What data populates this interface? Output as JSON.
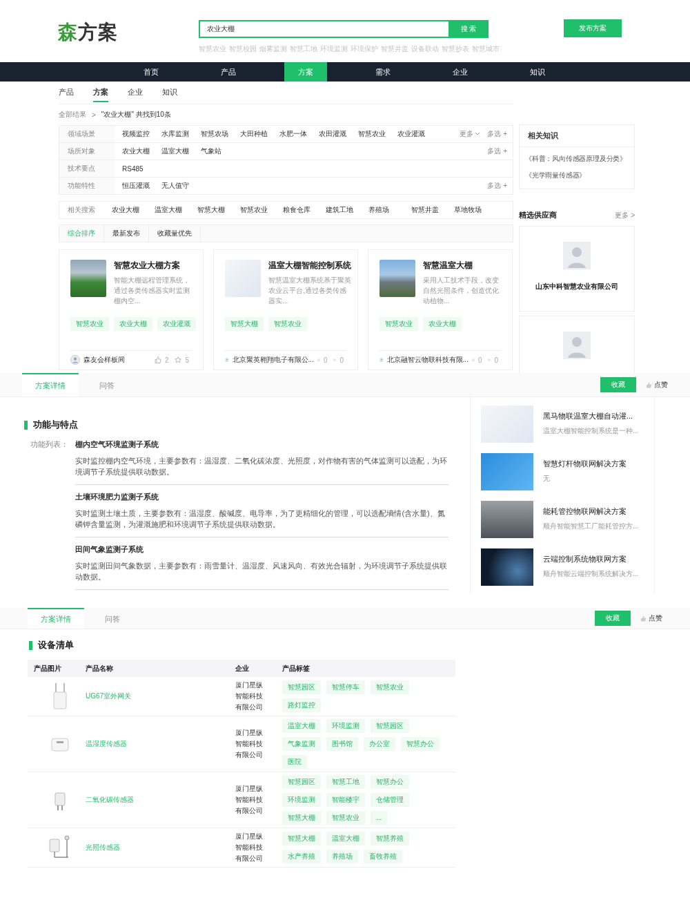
{
  "header": {
    "logo": {
      "accent": "森",
      "rest": "方案"
    },
    "search": {
      "value": "农业大棚",
      "button": "搜 索"
    },
    "hot_keywords": [
      "智慧农业",
      "智慧校园",
      "烟雾监测",
      "智慧工地",
      "环境监测",
      "环境保护",
      "智慧井盖",
      "设备联动",
      "智慧抄表",
      "智慧城市"
    ],
    "publish_button": "发布方案"
  },
  "nav": [
    {
      "label": "首页",
      "selected": false
    },
    {
      "label": "产品",
      "selected": false
    },
    {
      "label": "方案",
      "selected": true
    },
    {
      "label": "需求",
      "selected": false
    },
    {
      "label": "企业",
      "selected": false
    },
    {
      "label": "知识",
      "selected": false
    }
  ],
  "sub_tabs": [
    {
      "label": "产品",
      "selected": false
    },
    {
      "label": "方案",
      "selected": true
    },
    {
      "label": "企业",
      "selected": false
    },
    {
      "label": "知识",
      "selected": false
    }
  ],
  "breadcrumb": {
    "root": "全部结果",
    "separator": ">",
    "result": "\"农业大棚\" 共找到10条"
  },
  "filters": [
    {
      "label": "领域场景",
      "options": [
        "视频监控",
        "水库监测",
        "智慧农场",
        "大田种植",
        "水肥一体",
        "农田灌溉",
        "智慧农业",
        "农业灌溉"
      ],
      "more_label": "更多",
      "multi_label": "多选 +"
    },
    {
      "label": "场所对象",
      "options": [
        "农业大棚",
        "温室大棚",
        "气象站"
      ],
      "multi_label": "多选 +"
    },
    {
      "label": "技术要点",
      "options": [
        "RS485"
      ]
    },
    {
      "label": "功能特性",
      "options": [
        "恒压灌溉",
        "无人值守"
      ],
      "multi_label": "多选 +"
    }
  ],
  "related_search": {
    "label": "相关搜索",
    "items": [
      "农业大棚",
      "温室大棚",
      "智慧大棚",
      "智慧农业",
      "粮食仓库",
      "建筑工地",
      "养殖场",
      "智慧井盖",
      "草地牧场"
    ]
  },
  "sort_tabs": [
    {
      "label": "综合排序",
      "selected": true
    },
    {
      "label": "最新发布",
      "selected": false
    },
    {
      "label": "收藏量优先",
      "selected": false
    }
  ],
  "cards": [
    {
      "kind": "greenhouse",
      "title": "智慧农业大棚方案",
      "desc": "智能大棚远程管理系统，通过各类传感器实时监测棚内空...",
      "tags": [
        "智慧农业",
        "农业大棚",
        "农业灌溉"
      ],
      "author": "森友会样板间",
      "likes": "2",
      "stars": "5"
    },
    {
      "kind": "diagram",
      "title": "温室大棚智能控制系统",
      "desc": "智慧温室大棚系统基于聚英农业云平台,通过各类传感器实...",
      "tags": [
        "智慧大棚",
        "智慧农业"
      ],
      "author": "北京聚英翱翔电子有限公...",
      "likes": "0",
      "stars": "0"
    },
    {
      "kind": "building",
      "title": "智慧温室大棚",
      "desc": "采用人工技术手段，改变自然光照条件，创造优化动植物...",
      "tags": [
        "智慧农业",
        "农业大棚"
      ],
      "author": "北京融智云物联科技有限...",
      "likes": "0",
      "stars": "0"
    }
  ],
  "knowledge": {
    "title": "相关知识",
    "items": [
      "《科普：风向传感器原理及分类》",
      "《光学雨量传感器》"
    ]
  },
  "suppliers": {
    "title": "精选供应商",
    "more": "更多 >",
    "items": [
      {
        "kind": "named",
        "name": "山东中科智慧农业有限公司"
      },
      {
        "kind": "partial"
      }
    ]
  },
  "detail_tabs_1": {
    "tabs": [
      {
        "label": "方案详情",
        "selected": true
      },
      {
        "label": "问答",
        "selected": false
      }
    ],
    "collect": "收藏",
    "like": "点赞"
  },
  "features": {
    "heading": "功能与特点",
    "list_label": "功能列表：",
    "items": [
      {
        "title": "棚内空气环境监测子系统",
        "desc": "实时监控棚内空气环境，主要参数有：温湿度、二氧化碳浓度、光照度，对作物有害的气体监测可以选配，为环境调节子系统提供联动数据。"
      },
      {
        "title": "土壤环境肥力监测子系统",
        "desc": "实时监测土壤土质，主要参数有：温湿度、酸碱度、电导率，为了更精细化的管理，可以选配墒情(含水量)、氮磷钾含量监测，为灌溉施肥和环境调节子系统提供联动数据。"
      },
      {
        "title": "田间气象监测子系统",
        "desc": "实时监测田间气象数据，主要参数有：雨雪量计、温湿度、风速风向、有效光合辐射，为环境调节子系统提供联动数据。"
      }
    ]
  },
  "related_solutions": [
    {
      "kind": "diagram",
      "title": "黑马物联温室大棚自动灌...",
      "desc": "温室大棚智能控制系统是一种..."
    },
    {
      "kind": "blue",
      "title": "智慧灯杆物联网解决方案",
      "desc": "无"
    },
    {
      "kind": "factory",
      "title": "能耗管控物联网解决方案",
      "desc": "顺舟智能智慧工厂能耗管控方..."
    },
    {
      "kind": "network",
      "title": "云端控制系统物联网方案",
      "desc": "顺舟智能云端控制系统解决方..."
    }
  ],
  "detail_tabs_2": {
    "tabs": [
      {
        "label": "方案详情",
        "selected": true
      },
      {
        "label": "问答",
        "selected": false
      }
    ],
    "collect": "收藏",
    "like": "点赞"
  },
  "equipment": {
    "heading": "设备清单",
    "columns": [
      "产品图片",
      "产品名称",
      "企业",
      "产品标签"
    ],
    "rows": [
      {
        "kind": "gateway",
        "name": "UG67室外网关",
        "company": "厦门星纵智能科技有限公司",
        "tags": [
          "智慧园区",
          "智慧停车",
          "智慧农业",
          "路灯监控"
        ]
      },
      {
        "kind": "sensor",
        "name": "温湿度传感器",
        "company": "厦门星纵智能科技有限公司",
        "tags": [
          "温室大棚",
          "环境监测",
          "智慧园区",
          "气象监测",
          "图书馆",
          "办公室",
          "智慧办公",
          "医院"
        ]
      },
      {
        "kind": "plug",
        "name": "二氧化碳传感器",
        "company": "厦门星纵智能科技有限公司",
        "tags": [
          "智慧园区",
          "智慧工地",
          "智慧办公",
          "环境监测",
          "智能楼宇",
          "仓储管理",
          "智慧大棚",
          "智慧农业",
          "..."
        ]
      },
      {
        "kind": "probe",
        "name": "光照传感器",
        "company": "厦门星纵智能科技有限公司",
        "tags": [
          "智慧大棚",
          "温室大棚",
          "智慧养殖",
          "水产养殖",
          "养殖场",
          "畜牧养殖"
        ]
      }
    ]
  }
}
